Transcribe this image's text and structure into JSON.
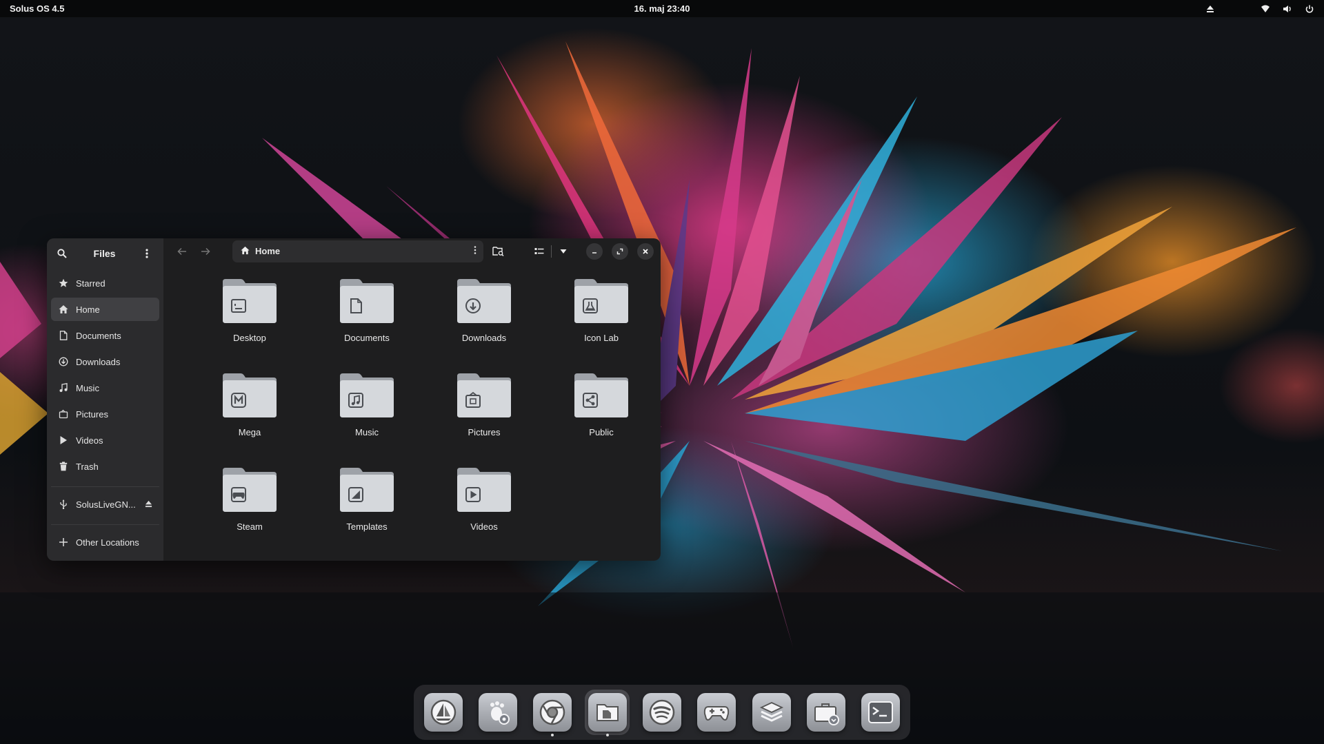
{
  "topbar": {
    "os_label": "Solus OS 4.5",
    "clock": "16. maj  23:40",
    "tray": [
      "eject-icon",
      "wifi-icon",
      "volume-icon",
      "power-icon"
    ]
  },
  "window": {
    "title": "Files",
    "path": "Home",
    "places": [
      {
        "name": "starred",
        "label": "Starred",
        "icon": "star-icon",
        "active": false
      },
      {
        "name": "home",
        "label": "Home",
        "icon": "home-icon",
        "active": true
      },
      {
        "name": "documents",
        "label": "Documents",
        "icon": "document-icon",
        "active": false
      },
      {
        "name": "downloads",
        "label": "Downloads",
        "icon": "download-icon",
        "active": false
      },
      {
        "name": "music",
        "label": "Music",
        "icon": "music-icon",
        "active": false
      },
      {
        "name": "pictures",
        "label": "Pictures",
        "icon": "pictures-icon",
        "active": false
      },
      {
        "name": "videos",
        "label": "Videos",
        "icon": "play-icon",
        "active": false
      },
      {
        "name": "trash",
        "label": "Trash",
        "icon": "trash-icon",
        "active": false
      }
    ],
    "device": {
      "label": "SolusLiveGN...",
      "icon": "usb-icon"
    },
    "other_locations": "Other Locations",
    "folders": [
      {
        "label": "Desktop",
        "icon": "desktop-icon"
      },
      {
        "label": "Documents",
        "icon": "document-icon"
      },
      {
        "label": "Downloads",
        "icon": "download-icon"
      },
      {
        "label": "Icon Lab",
        "icon": "flask-icon"
      },
      {
        "label": "Mega",
        "icon": "mega-icon"
      },
      {
        "label": "Music",
        "icon": "music-icon"
      },
      {
        "label": "Pictures",
        "icon": "pictures-icon"
      },
      {
        "label": "Public",
        "icon": "share-icon"
      },
      {
        "label": "Steam",
        "icon": "gamepad-icon"
      },
      {
        "label": "Templates",
        "icon": "template-icon"
      },
      {
        "label": "Videos",
        "icon": "play-icon"
      }
    ]
  },
  "dock": [
    {
      "name": "budgie-settings",
      "icon": "sailboat-icon",
      "running": false
    },
    {
      "name": "gnome-settings",
      "icon": "gnome-settings-icon",
      "running": false
    },
    {
      "name": "chrome",
      "icon": "chrome-icon",
      "running": true
    },
    {
      "name": "files",
      "icon": "folder-icon",
      "running": true,
      "active": true
    },
    {
      "name": "spotify",
      "icon": "spotify-icon",
      "running": false
    },
    {
      "name": "steam-games",
      "icon": "gamepad-icon",
      "running": false
    },
    {
      "name": "stack-app",
      "icon": "layers-icon",
      "running": false
    },
    {
      "name": "software-center",
      "icon": "briefcase-icon",
      "running": false
    },
    {
      "name": "terminal",
      "icon": "terminal-icon",
      "running": false
    }
  ],
  "colors": {
    "sidebar_bg": "#2b2b2d",
    "main_bg": "#1e1e1f",
    "folder_light": "#d5d8dc",
    "folder_dark": "#9ea2a8"
  }
}
